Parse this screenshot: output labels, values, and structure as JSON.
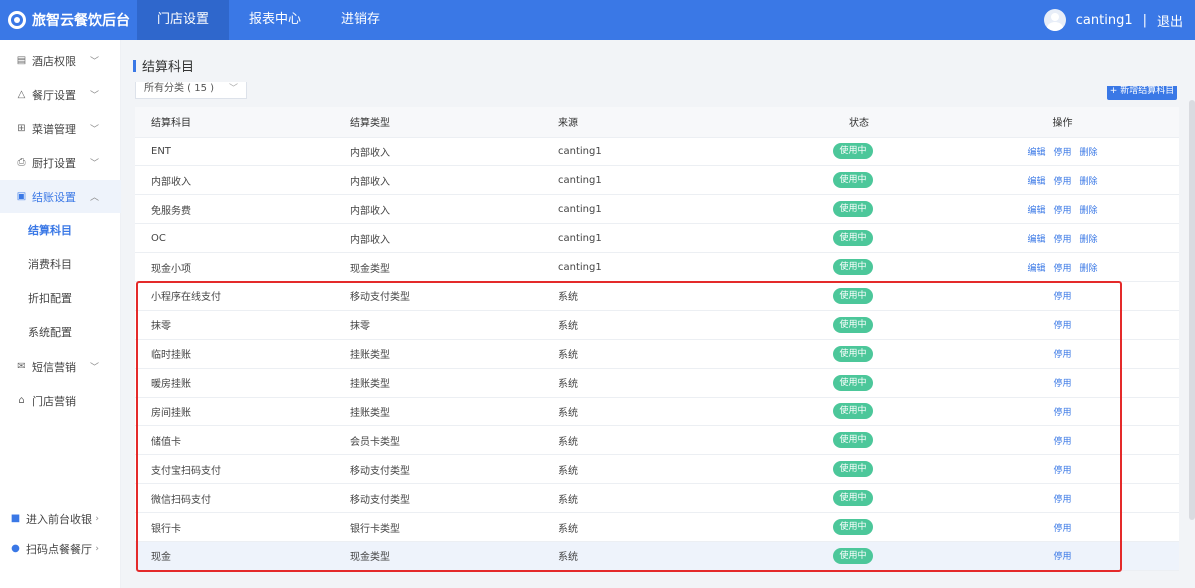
{
  "brand": {
    "title": "旅智云餐饮后台"
  },
  "topnav": [
    {
      "label": "门店设置",
      "active": true
    },
    {
      "label": "报表中心",
      "active": false
    },
    {
      "label": "进销存",
      "active": false
    }
  ],
  "user": {
    "name": "canting1",
    "separator": "|",
    "logout": "退出"
  },
  "sidebar": {
    "items": [
      {
        "label": "酒店权限",
        "icon": "hotel-icon"
      },
      {
        "label": "餐厅设置",
        "icon": "restaurant-icon"
      },
      {
        "label": "菜谱管理",
        "icon": "menu-grid-icon"
      },
      {
        "label": "厨打设置",
        "icon": "printer-icon"
      },
      {
        "label": "结账设置",
        "icon": "checkout-icon"
      },
      {
        "label": "短信营销",
        "icon": "mail-icon"
      },
      {
        "label": "门店营销",
        "icon": "store-icon"
      }
    ],
    "sub_items": [
      "结算科目",
      "消费科目",
      "折扣配置",
      "系统配置"
    ],
    "bottom": [
      {
        "label": "进入前台收银",
        "icon": "cashier-icon"
      },
      {
        "label": "扫码点餐餐厅",
        "icon": "location-icon"
      }
    ]
  },
  "page": {
    "title": "结算科目",
    "filter_value": "所有分类 ( 15 )",
    "add_button": "+ 新增结算科目"
  },
  "table": {
    "headers": [
      "结算科目",
      "结算类型",
      "来源",
      "状态",
      "操作"
    ],
    "rows": [
      {
        "name": "ENT",
        "type": "内部收入",
        "source": "canting1",
        "status": "使用中",
        "ops": [
          "编辑",
          "停用",
          "删除"
        ]
      },
      {
        "name": "内部收入",
        "type": "内部收入",
        "source": "canting1",
        "status": "使用中",
        "ops": [
          "编辑",
          "停用",
          "删除"
        ]
      },
      {
        "name": "免服务费",
        "type": "内部收入",
        "source": "canting1",
        "status": "使用中",
        "ops": [
          "编辑",
          "停用",
          "删除"
        ]
      },
      {
        "name": "OC",
        "type": "内部收入",
        "source": "canting1",
        "status": "使用中",
        "ops": [
          "编辑",
          "停用",
          "删除"
        ]
      },
      {
        "name": "现金小项",
        "type": "现金类型",
        "source": "canting1",
        "status": "使用中",
        "ops": [
          "编辑",
          "停用",
          "删除"
        ]
      },
      {
        "name": "小程序在线支付",
        "type": "移动支付类型",
        "source": "系统",
        "status": "使用中",
        "ops": [
          "停用"
        ]
      },
      {
        "name": "抹零",
        "type": "抹零",
        "source": "系统",
        "status": "使用中",
        "ops": [
          "停用"
        ]
      },
      {
        "name": "临时挂账",
        "type": "挂账类型",
        "source": "系统",
        "status": "使用中",
        "ops": [
          "停用"
        ]
      },
      {
        "name": "暖房挂账",
        "type": "挂账类型",
        "source": "系统",
        "status": "使用中",
        "ops": [
          "停用"
        ]
      },
      {
        "name": "房间挂账",
        "type": "挂账类型",
        "source": "系统",
        "status": "使用中",
        "ops": [
          "停用"
        ]
      },
      {
        "name": "储值卡",
        "type": "会员卡类型",
        "source": "系统",
        "status": "使用中",
        "ops": [
          "停用"
        ]
      },
      {
        "name": "支付宝扫码支付",
        "type": "移动支付类型",
        "source": "系统",
        "status": "使用中",
        "ops": [
          "停用"
        ]
      },
      {
        "name": "微信扫码支付",
        "type": "移动支付类型",
        "source": "系统",
        "status": "使用中",
        "ops": [
          "停用"
        ]
      },
      {
        "name": "银行卡",
        "type": "银行卡类型",
        "source": "系统",
        "status": "使用中",
        "ops": [
          "停用"
        ]
      },
      {
        "name": "现金",
        "type": "现金类型",
        "source": "系统",
        "status": "使用中",
        "ops": [
          "停用"
        ]
      }
    ]
  },
  "colors": {
    "primary": "#3a78e6",
    "status_green": "#4cc79a",
    "highlight_red": "#e42a2a"
  }
}
